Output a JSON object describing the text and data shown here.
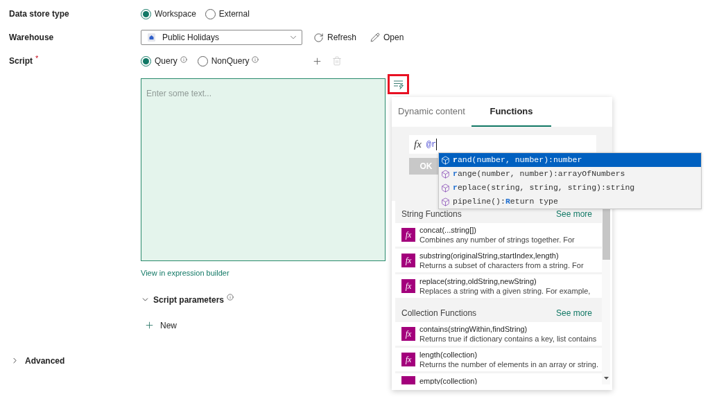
{
  "form": {
    "data_store_type": {
      "label": "Data store type",
      "options": [
        {
          "label": "Workspace",
          "selected": true
        },
        {
          "label": "External",
          "selected": false
        }
      ]
    },
    "warehouse": {
      "label": "Warehouse",
      "value": "Public Holidays",
      "actions": [
        {
          "kind": "refresh",
          "label": "Refresh"
        },
        {
          "kind": "open",
          "label": "Open"
        }
      ]
    },
    "script": {
      "label": "Script",
      "required_mark": "*",
      "types": [
        {
          "label": "Query",
          "selected": true,
          "info": true
        },
        {
          "label": "NonQuery",
          "selected": false,
          "info": true
        }
      ],
      "tools": [
        {
          "kind": "add",
          "disabled": false
        },
        {
          "kind": "delete",
          "disabled": true
        }
      ],
      "placeholder": "Enter some text...",
      "builder_button": {
        "highlighted": true
      },
      "builder_link": "View in expression builder"
    },
    "script_parameters": {
      "label": "Script parameters",
      "expanded": true,
      "info": true,
      "new_label": "New"
    },
    "advanced": {
      "label": "Advanced",
      "expanded": false
    }
  },
  "popup": {
    "tabs": [
      {
        "label": "Dynamic content",
        "selected": false
      },
      {
        "label": "Functions",
        "selected": true
      }
    ],
    "expression": {
      "prefix": "fx",
      "value": "@r"
    },
    "ok_button": {
      "label": "OK",
      "disabled": true
    },
    "suggestions": [
      {
        "text": "**r**and(number, number):number",
        "selected": true
      },
      {
        "text": "**r**ange(number, number):arrayOfNumbers",
        "selected": false
      },
      {
        "text": "**r**eplace(string, string, string):string",
        "selected": false
      },
      {
        "text": "pipeline():**R**eturn type",
        "selected": false
      }
    ],
    "sections": [
      {
        "title": "String Functions",
        "see_more": "See more",
        "items": [
          {
            "badge": "fx",
            "name": "concat(...string[])",
            "description": "Combines any number of strings together. For"
          },
          {
            "badge": "fx",
            "name": "substring(originalString,startIndex,length)",
            "description": "Returns a subset of characters from a string. For"
          },
          {
            "badge": "fx",
            "name": "replace(string,oldString,newString)",
            "description": "Replaces a string with a given string. For example,"
          }
        ]
      },
      {
        "title": "Collection Functions",
        "see_more": "See more",
        "items": [
          {
            "badge": "fx",
            "name": "contains(stringWithin,findString)",
            "description": "Returns true if dictionary contains a key, list contains"
          },
          {
            "badge": "fx",
            "name": "length(collection)",
            "description": "Returns the number of elements in an array or string."
          },
          {
            "name": "empty(collection)"
          }
        ]
      }
    ]
  }
}
